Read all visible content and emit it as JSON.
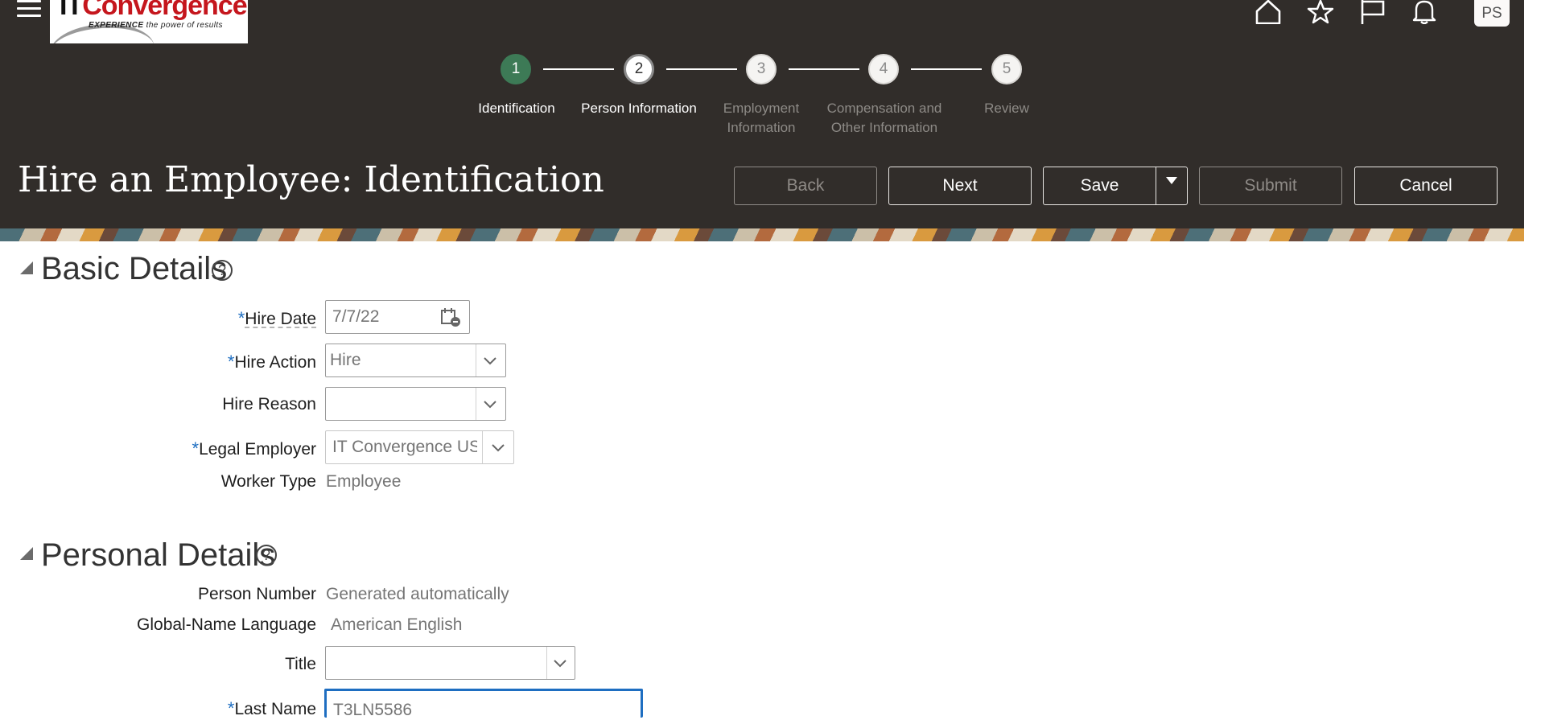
{
  "header": {
    "logo": {
      "brand": "ITConvergence",
      "tagline": "EXPERIENCE the power of results"
    },
    "avatar_initials": "PS",
    "icons": [
      "home-icon",
      "star-icon",
      "flag-icon",
      "bell-icon"
    ]
  },
  "train": {
    "steps": [
      {
        "number": "1",
        "label": "Identification",
        "state": "done"
      },
      {
        "number": "2",
        "label": "Person Information",
        "state": "visited"
      },
      {
        "number": "3",
        "label": "Employment Information",
        "state": "future"
      },
      {
        "number": "4",
        "label": "Compensation and Other Information",
        "state": "future"
      },
      {
        "number": "5",
        "label": "Review",
        "state": "future"
      }
    ]
  },
  "page_title": "Hire an Employee: Identification",
  "actions": {
    "back": "Back",
    "next": "Next",
    "save": "Save",
    "submit": "Submit",
    "cancel": "Cancel"
  },
  "colors": {
    "header_bg": "#312d2a",
    "step_done": "#3d7a56",
    "required": "#1e6ec1",
    "focus": "#1e6ec1"
  },
  "basic_details": {
    "title": "Basic Details",
    "hire_date": {
      "label": "Hire Date",
      "value": "7/7/22"
    },
    "hire_action": {
      "label": "Hire Action",
      "value": "Hire"
    },
    "hire_reason": {
      "label": "Hire Reason",
      "value": ""
    },
    "legal_employer": {
      "label": "Legal Employer",
      "value": "IT Convergence USA"
    },
    "worker_type": {
      "label": "Worker Type",
      "value": "Employee"
    }
  },
  "personal_details": {
    "title": "Personal Details",
    "person_number": {
      "label": "Person Number",
      "value": "Generated automatically"
    },
    "global_name_language": {
      "label": "Global-Name Language",
      "value": "American English"
    },
    "title_field": {
      "label": "Title",
      "value": ""
    },
    "last_name": {
      "label": "Last Name",
      "value": "T3LN5586"
    }
  },
  "required_marker": "*"
}
